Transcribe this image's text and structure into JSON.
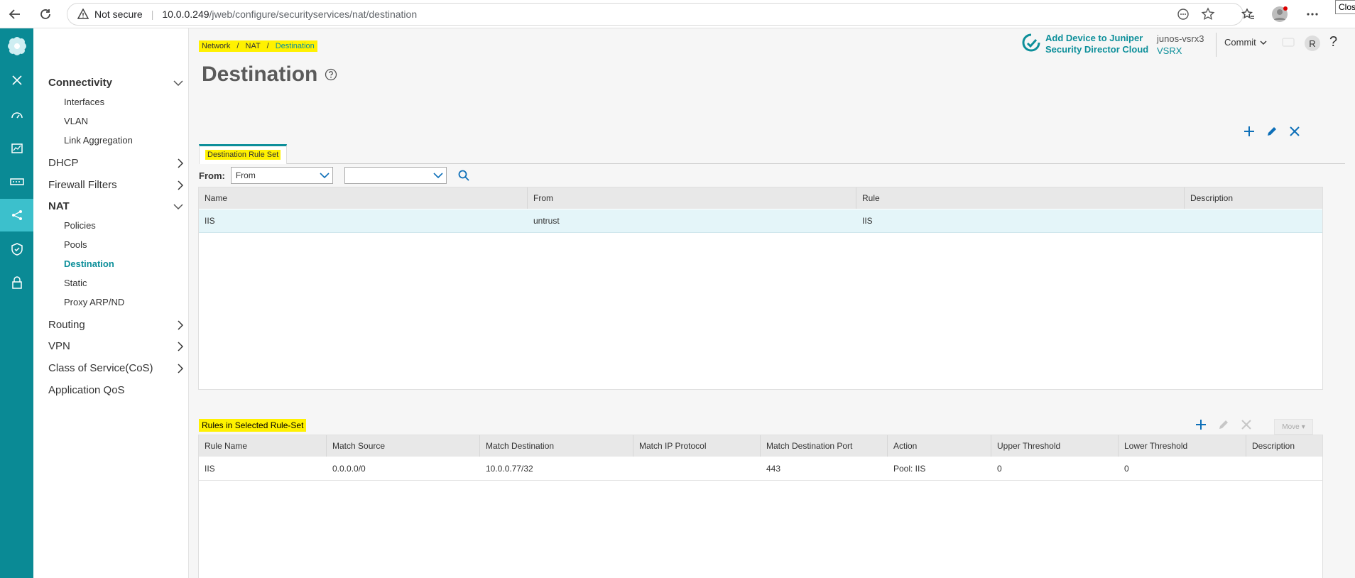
{
  "browser": {
    "not_secure": "Not secure",
    "url_host": "10.0.0.249",
    "url_path": "/jweb/configure/securityservices/nat/destination",
    "close_tooltip": "Close"
  },
  "header": {
    "breadcrumb": [
      "Network",
      "NAT",
      "Destination"
    ],
    "breadcrumb_sep": "/",
    "title": "Destination",
    "sdc_line1": "Add Device to Juniper",
    "sdc_line2": "Security Director Cloud",
    "device_name": "junos-vsrx3",
    "device_type": "VSRX",
    "commit_label": "Commit",
    "avatar_initial": "R",
    "help_glyph": "?"
  },
  "nav": {
    "groups": [
      {
        "label": "Connectivity",
        "expanded": true,
        "bold": true,
        "items": [
          "Interfaces",
          "VLAN",
          "Link Aggregation"
        ]
      },
      {
        "label": "DHCP",
        "expanded": false
      },
      {
        "label": "Firewall Filters",
        "expanded": false
      },
      {
        "label": "NAT",
        "expanded": true,
        "bold": true,
        "items": [
          "Policies",
          "Pools",
          "Destination",
          "Static",
          "Proxy ARP/ND"
        ]
      },
      {
        "label": "Routing",
        "expanded": false
      },
      {
        "label": "VPN",
        "expanded": false
      },
      {
        "label": "Class of Service(CoS)",
        "expanded": false
      },
      {
        "label": "Application QoS"
      }
    ],
    "selected": "Destination"
  },
  "tabs": [
    "Destination Rule Set"
  ],
  "filter": {
    "label": "From:",
    "select1_value": "From",
    "select2_value": ""
  },
  "rule_sets": {
    "columns": [
      "Name",
      "From",
      "Rule",
      "Description"
    ],
    "rows": [
      [
        "IIS",
        "untrust",
        "IIS",
        ""
      ]
    ]
  },
  "rules": {
    "title": "Rules in Selected Rule-Set",
    "move_label": "Move",
    "columns": [
      "Rule Name",
      "Match Source",
      "Match Destination",
      "Match IP Protocol",
      "Match Destination Port",
      "Action",
      "Upper Threshold",
      "Lower Threshold",
      "Description"
    ],
    "rows": [
      [
        "IIS",
        "0.0.0.0/0",
        "10.0.0.77/32",
        "",
        "443",
        "Pool: IIS",
        "0",
        "0",
        ""
      ]
    ]
  },
  "colors": {
    "accent": "#0d8f9a",
    "rail": "#0a8a95",
    "highlight": "#fff100"
  }
}
